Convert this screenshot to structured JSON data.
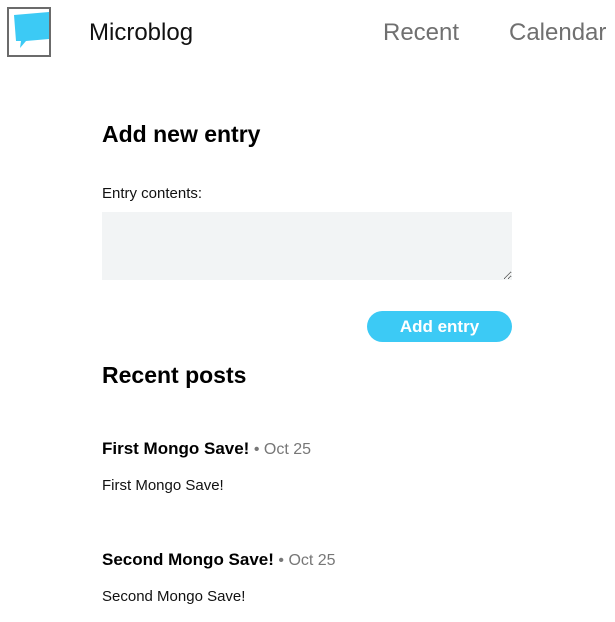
{
  "header": {
    "brand": "Microblog",
    "nav": [
      {
        "label": "Recent"
      },
      {
        "label": "Calendar"
      }
    ]
  },
  "form": {
    "heading": "Add new entry",
    "label": "Entry contents:",
    "value": "",
    "button_label": "Add entry"
  },
  "recent": {
    "heading": "Recent posts",
    "posts": [
      {
        "title": "First Mongo Save!",
        "date": "Oct 25",
        "body": "First Mongo Save!"
      },
      {
        "title": "Second Mongo Save!",
        "date": "Oct 25",
        "body": "Second Mongo Save!"
      }
    ]
  },
  "colors": {
    "accent": "#3ccaf5",
    "textarea_bg": "#f2f4f5",
    "nav_text": "#707070"
  },
  "icons": {
    "logo": "speech-bubble-icon"
  }
}
